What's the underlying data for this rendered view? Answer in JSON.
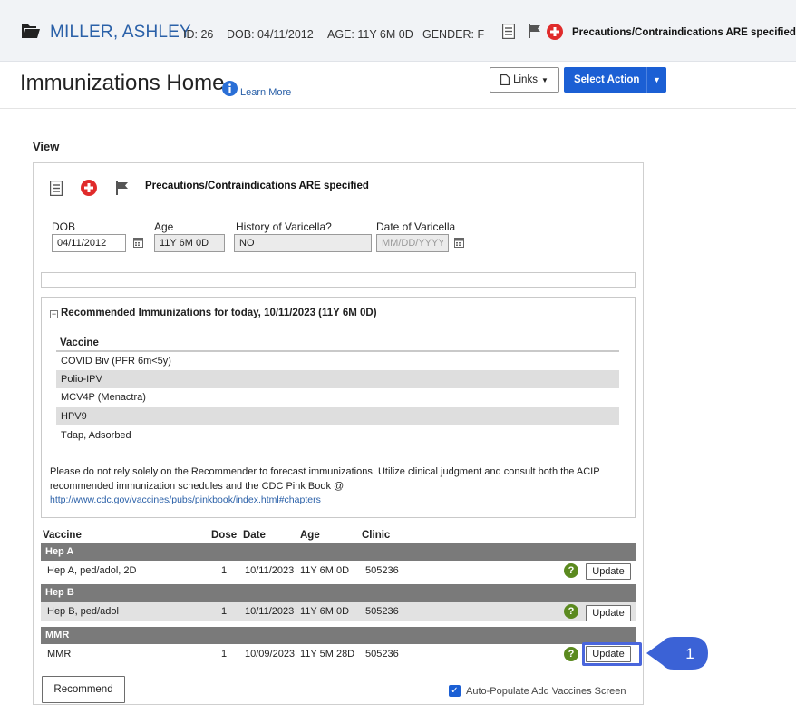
{
  "patient": {
    "name": "MILLER, ASHLEY",
    "id_label": "ID:",
    "id": "26",
    "dob_label": "DOB:",
    "dob": "04/11/2012",
    "age_label": "AGE:",
    "age": "11Y 6M 0D",
    "gender_label": "GENDER:",
    "gender": "F",
    "precaution": "Precautions/Contraindications ARE specified"
  },
  "page": {
    "title": "Immunizations Home",
    "learn_more": "Learn More",
    "links_label": "Links",
    "select_action_label": "Select Action"
  },
  "view": {
    "label": "View",
    "precaution": "Precautions/Contraindications ARE specified",
    "fields": {
      "dob_label": "DOB",
      "dob_value": "04/11/2012",
      "age_label": "Age",
      "age_value": "11Y 6M 0D",
      "varicella_history_label": "History of Varicella?",
      "varicella_history_value": "NO",
      "varicella_date_label": "Date of Varicella",
      "varicella_date_placeholder": "MM/DD/YYYY"
    }
  },
  "recommended": {
    "toggle": "−",
    "title": "Recommended Immunizations for today, 10/11/2023 (11Y 6M 0D)",
    "column": "Vaccine",
    "items": [
      "COVID Biv (PFR 6m<5y)",
      "Polio-IPV",
      "MCV4P (Menactra)",
      "HPV9",
      "Tdap, Adsorbed"
    ],
    "note": "Please do not rely solely on the Recommender to forecast immunizations. Utilize clinical judgment and consult both the ACIP recommended immunization schedules and the CDC Pink Book @",
    "link": "http://www.cdc.gov/vaccines/pubs/pinkbook/index.html#chapters"
  },
  "table": {
    "headers": {
      "vaccine": "Vaccine",
      "dose": "Dose",
      "date": "Date",
      "age": "Age",
      "clinic": "Clinic"
    },
    "groups": [
      {
        "name": "Hep A",
        "row": {
          "vaccine": "Hep A, ped/adol, 2D",
          "dose": "1",
          "date": "10/11/2023",
          "age": "11Y 6M 0D",
          "clinic": "505236"
        }
      },
      {
        "name": "Hep B",
        "row": {
          "vaccine": "Hep B, ped/adol",
          "dose": "1",
          "date": "10/11/2023",
          "age": "11Y 6M 0D",
          "clinic": "505236"
        }
      },
      {
        "name": "MMR",
        "row": {
          "vaccine": "MMR",
          "dose": "1",
          "date": "10/09/2023",
          "age": "11Y 5M 28D",
          "clinic": "505236"
        }
      }
    ],
    "help_glyph": "?",
    "update_label": "Update"
  },
  "footer": {
    "recommend_label": "Recommend",
    "auto_populate_label": "Auto-Populate Add Vaccines Screen",
    "auto_populate_checked": true
  },
  "callout": {
    "number": "1"
  },
  "colors": {
    "brand_blue": "#1b5fd4",
    "link_blue": "#2a60a8",
    "plus_red": "#e02b2b",
    "help_green": "#5b8a1f",
    "highlight": "#4a66dc"
  }
}
